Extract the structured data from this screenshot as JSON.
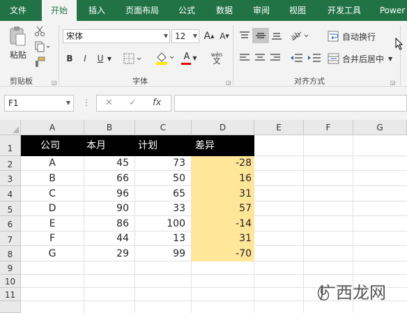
{
  "tabs": [
    "文件",
    "开始",
    "插入",
    "页面布局",
    "公式",
    "数据",
    "审阅",
    "视图",
    "开发工具",
    "Power"
  ],
  "ribbon": {
    "paste_label": "粘贴",
    "clipboard_label": "剪贴板",
    "font_label": "字体",
    "align_label": "对齐方式",
    "font_name": "宋体",
    "font_size": "12",
    "bold": "B",
    "italic": "I",
    "underline": "U",
    "grow_font": "A",
    "shrink_font": "A",
    "font_color": "A",
    "wen": "wén",
    "wrap_text": "自动换行",
    "merge_center": "合并后居中"
  },
  "formula_bar": {
    "name_box": "F1",
    "cancel": "✕",
    "enter": "✓",
    "fx": "fx",
    "formula": ""
  },
  "columns": [
    "A",
    "B",
    "C",
    "D",
    "E",
    "F",
    "G"
  ],
  "rows": [
    "1",
    "2",
    "3",
    "4",
    "5",
    "6",
    "7",
    "8",
    "9",
    "10",
    "11"
  ],
  "table": {
    "headers": [
      "公司",
      "本月",
      "计划",
      "差异"
    ],
    "data": [
      [
        "A",
        "45",
        "73",
        "-28"
      ],
      [
        "B",
        "66",
        "50",
        "16"
      ],
      [
        "C",
        "96",
        "65",
        "31"
      ],
      [
        "D",
        "90",
        "33",
        "57"
      ],
      [
        "E",
        "86",
        "100",
        "-14"
      ],
      [
        "F",
        "44",
        "13",
        "31"
      ],
      [
        "G",
        "29",
        "99",
        "-70"
      ]
    ]
  },
  "watermark": "广西龙网",
  "colors": {
    "accent": "#217346",
    "highlight": "#ffe699",
    "header_bg": "#000000"
  }
}
